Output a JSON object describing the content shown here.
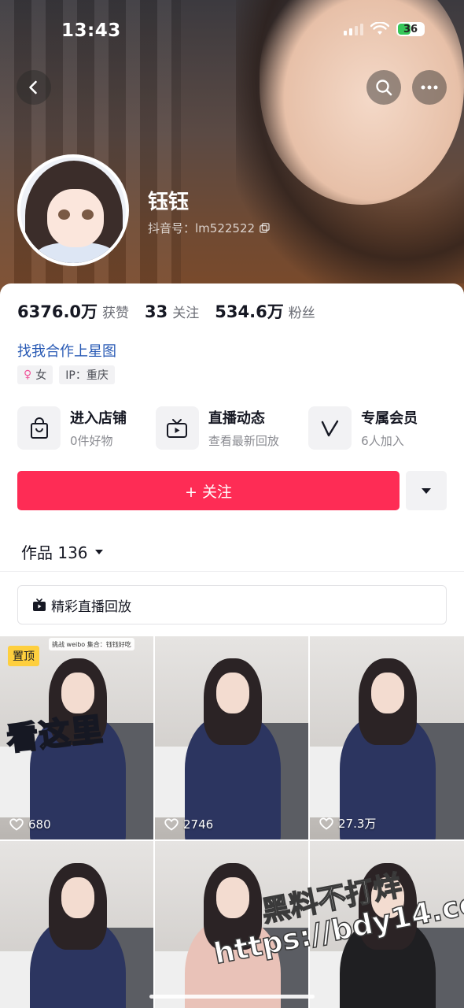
{
  "status_bar": {
    "time": "13:43",
    "battery": "36"
  },
  "profile": {
    "nickname": "钰钰",
    "douyin_id": "抖音号：lm522522",
    "stats": [
      {
        "value": "6376.0万",
        "label": "获赞"
      },
      {
        "value": "33",
        "label": "关注"
      },
      {
        "value": "534.6万",
        "label": "粉丝"
      }
    ],
    "bio": "找我合作上星图",
    "tags": {
      "gender": "女",
      "ip": "IP：重庆"
    }
  },
  "services": [
    {
      "title": "进入店铺",
      "subtitle": "0件好物",
      "icon": "shopping-bag-icon"
    },
    {
      "title": "直播动态",
      "subtitle": "查看最新回放",
      "icon": "tv-icon"
    },
    {
      "title": "专属会员",
      "subtitle": "6人加入",
      "icon": "v-icon"
    }
  ],
  "follow": {
    "label": "+ 关注"
  },
  "works": {
    "label": "作品 136"
  },
  "replay": {
    "label": "精彩直播回放"
  },
  "videos": [
    {
      "likes": "680",
      "pinned": "置顶",
      "caption": "看这里",
      "top_tag": "挑战 weibo 集合：钰钰好吃"
    },
    {
      "likes": "2746"
    },
    {
      "likes": "27.3万"
    },
    {
      "likes": ""
    },
    {
      "likes": ""
    },
    {
      "likes": ""
    }
  ],
  "watermark": {
    "line1": "黑料不打烊",
    "line2": "https://bdy14.co"
  },
  "colors": {
    "accent": "#fe2c55",
    "link": "#2a5bb5",
    "pin": "#fecf3e"
  }
}
